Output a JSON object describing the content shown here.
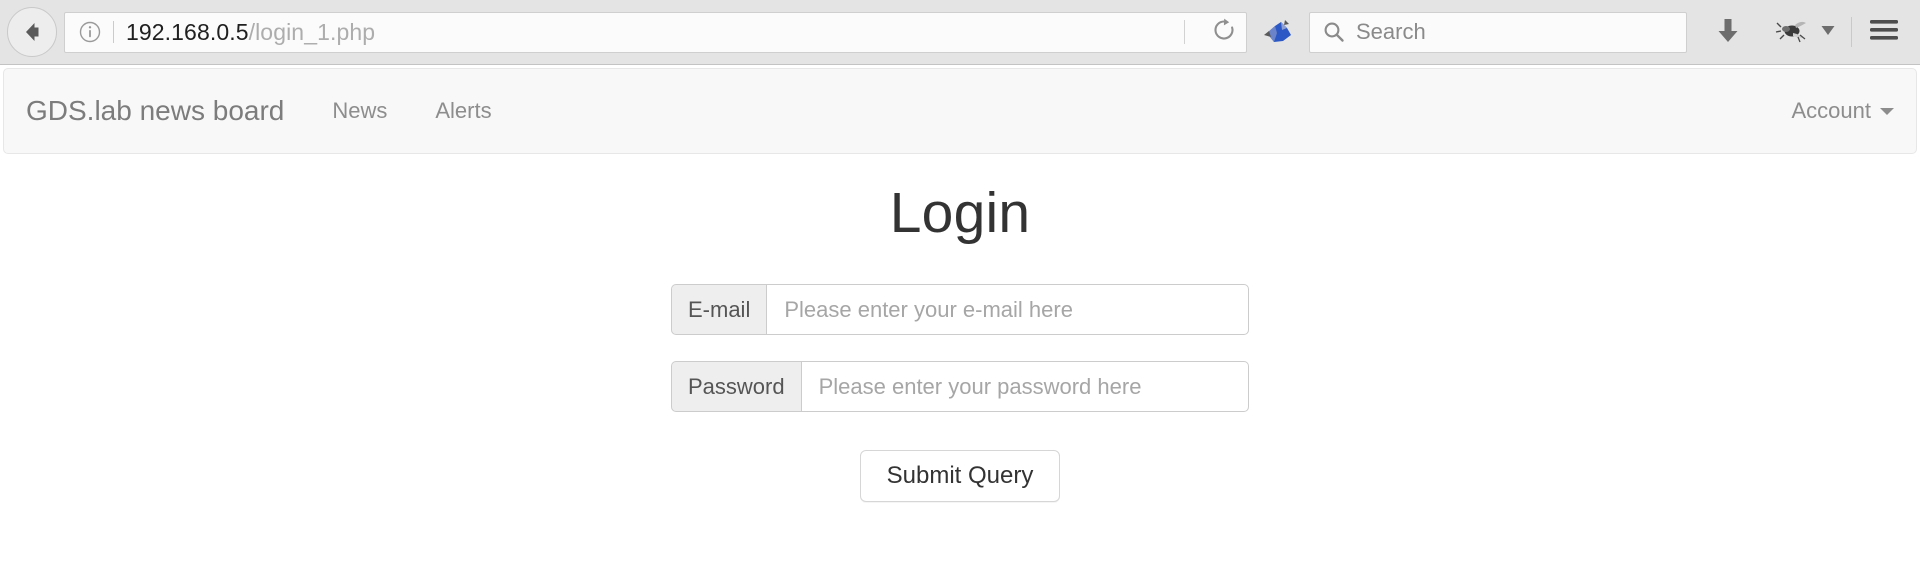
{
  "browser": {
    "back_icon": "back-arrow-icon",
    "identity_icon": "info-circle-icon",
    "url_host": "192.168.0.5",
    "url_path": "/login_1.php",
    "reload_icon": "reload-icon",
    "plugin_icon": "flash-plugin-icon",
    "search_icon": "search-icon",
    "search_value": "",
    "search_placeholder": "Search",
    "download_icon": "download-arrow-icon",
    "bug_icon": "bug-icon",
    "bug_caret_icon": "chevron-down-icon",
    "menu_icon": "hamburger-menu-icon"
  },
  "navbar": {
    "brand": "GDS.lab news board",
    "links": [
      {
        "label": "News"
      },
      {
        "label": "Alerts"
      }
    ],
    "account": {
      "label": "Account",
      "caret_icon": "caret-down-icon"
    }
  },
  "main": {
    "title": "Login",
    "fields": [
      {
        "addon": "E-mail",
        "value": "",
        "placeholder": "Please enter your e-mail here"
      },
      {
        "addon": "Password",
        "value": "",
        "placeholder": "Please enter your password here"
      }
    ],
    "submit_label": "Submit Query"
  },
  "colors": {
    "chrome_bg": "#e4e4e4",
    "navbar_bg": "#f8f8f8",
    "page_bg": "#ffffff",
    "text_muted": "#8d8d8d",
    "text_dark": "#333333",
    "plugin_blue": "#2b58c4"
  }
}
